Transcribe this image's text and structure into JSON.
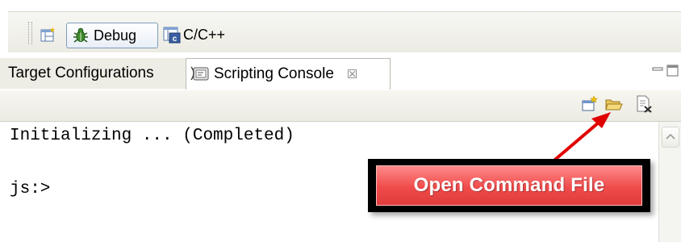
{
  "perspectives": {
    "items": [
      {
        "label": "Debug",
        "icon": "bug-icon",
        "active": true
      },
      {
        "label": "C/C++",
        "icon": "cpp-perspective-icon",
        "active": false
      }
    ],
    "open_icon": "open-perspective-icon"
  },
  "tabs": [
    {
      "label": "Target Configurations",
      "active": false
    },
    {
      "label": "Scripting Console",
      "icon": "scripting-console-icon",
      "close_glyph": "☒",
      "active": true
    }
  ],
  "toolbar": {
    "icons": [
      "new-command-icon",
      "open-command-file-icon",
      "clear-console-icon",
      "view-menu-icon"
    ]
  },
  "console": {
    "lines": [
      "Initializing ... (Completed)",
      "js:>"
    ]
  },
  "callout": {
    "label": "Open Command File",
    "color": "#e84545",
    "arrow_color": "#e00000"
  }
}
